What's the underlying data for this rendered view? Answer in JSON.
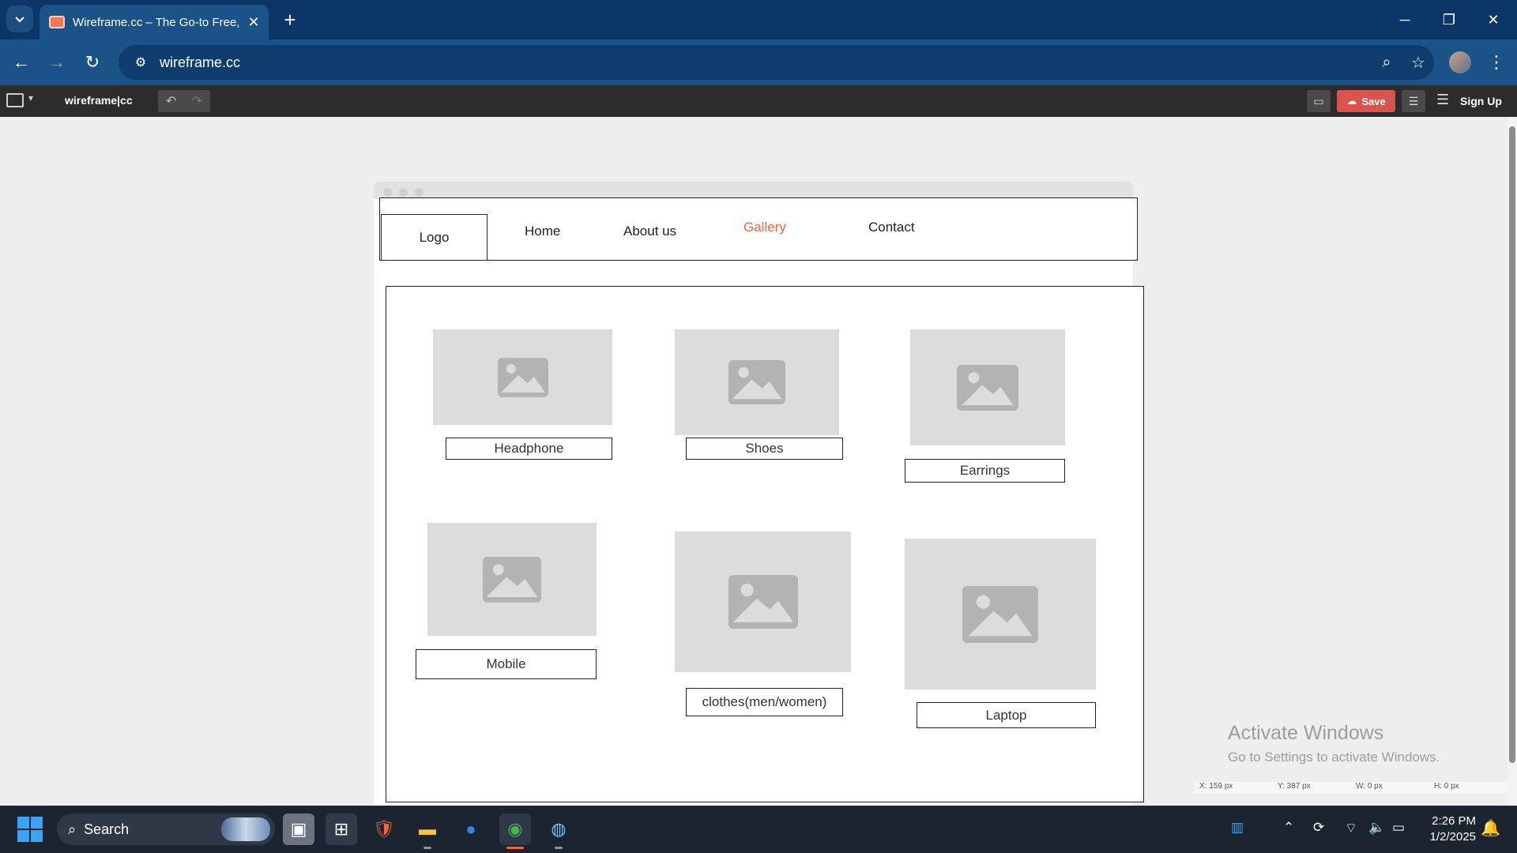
{
  "browser": {
    "tab_title": "Wireframe.cc – The Go-to Free,",
    "url": "wireframe.cc"
  },
  "app": {
    "logo": "wireframe|cc",
    "save_label": "Save",
    "signup_label": "Sign Up"
  },
  "wireframe": {
    "nav": {
      "logo": "Logo",
      "links": [
        "Home",
        "About us",
        "Gallery",
        "Contact"
      ],
      "active": "Gallery"
    },
    "gallery": [
      "Headphone",
      "Shoes",
      "Earrings",
      "Mobile",
      "clothes(men/women)",
      "Laptop"
    ]
  },
  "status": {
    "x": "X: 159 px",
    "y": "Y: 387 px",
    "w": "W: 0 px",
    "h": "H: 0 px"
  },
  "watermark": {
    "title": "Activate Windows",
    "subtitle": "Go to Settings to activate Windows."
  },
  "taskbar": {
    "search_label": "Search",
    "time": "2:26 PM",
    "date": "1/2/2025"
  },
  "colors": {
    "accent_active_link": "#f2643a",
    "save_button": "#d9534f",
    "browser_frame": "#0b3666"
  }
}
